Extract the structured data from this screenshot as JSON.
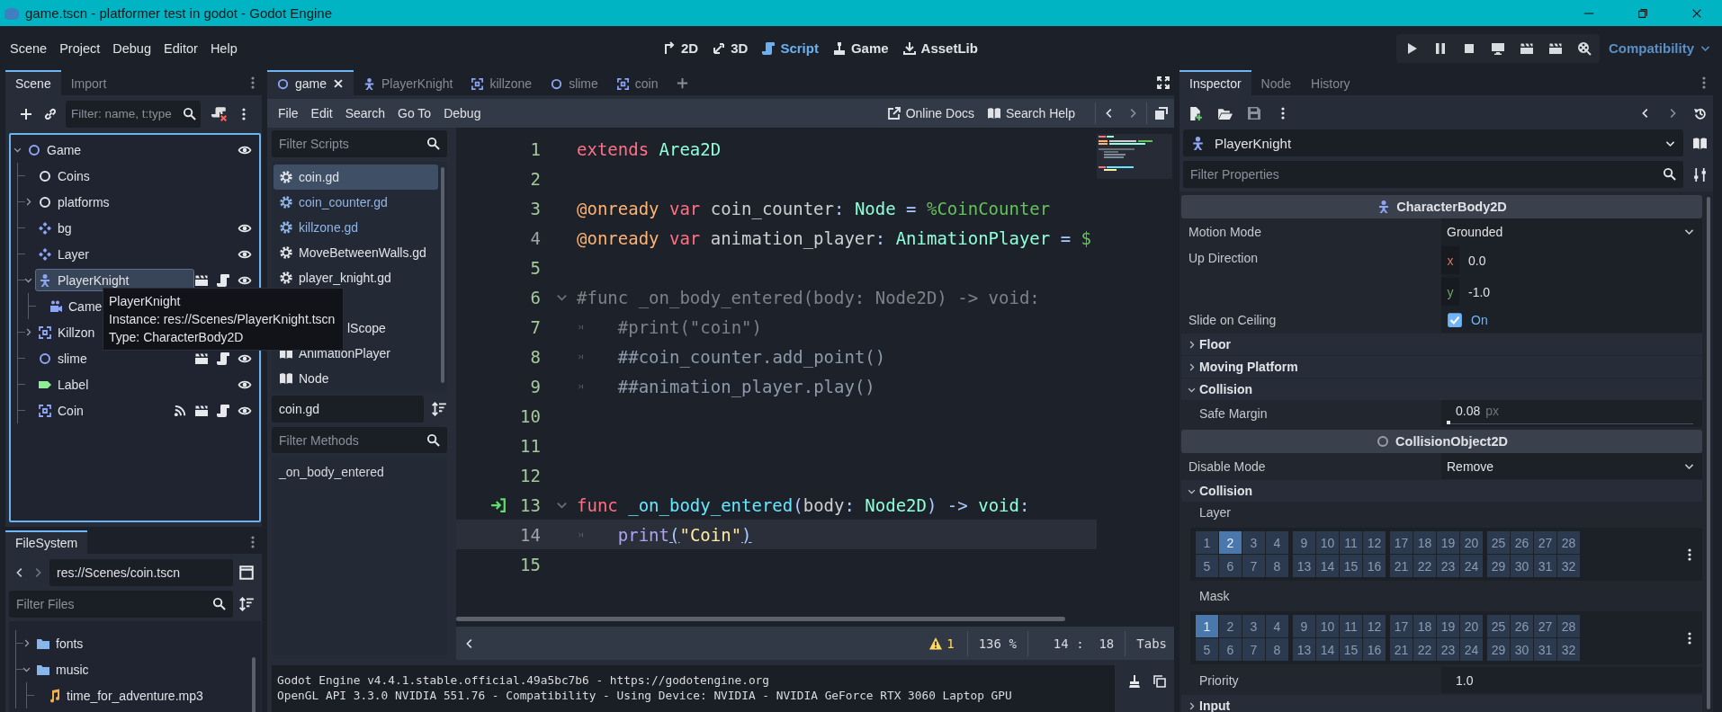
{
  "window": {
    "title": "game.tscn - platformer test in godot - Godot Engine"
  },
  "menu": [
    "Scene",
    "Project",
    "Debug",
    "Editor",
    "Help"
  ],
  "workspaces": [
    {
      "label": "2D",
      "kind": "planar",
      "selected": false
    },
    {
      "label": "3D",
      "kind": "spatial",
      "selected": false
    },
    {
      "label": "Script",
      "kind": "script",
      "selected": true
    },
    {
      "label": "Game",
      "kind": "game",
      "selected": false
    },
    {
      "label": "AssetLib",
      "kind": "assetlib",
      "selected": false
    }
  ],
  "renderer": "Compatibility",
  "scene_dock": {
    "tabs": [
      {
        "label": "Scene",
        "selected": true
      },
      {
        "label": "Import",
        "selected": false
      }
    ],
    "filter": {
      "placeholder": "Filter: name, t:type"
    },
    "tree": [
      {
        "label": "Game",
        "kind": "node2d",
        "expanded": true,
        "selected": false,
        "eye": true,
        "instanced": false,
        "script": false,
        "signals": false,
        "children": [
          {
            "label": "Coins",
            "kind": "node",
            "selected": false,
            "eye": false,
            "instanced": false,
            "script": false,
            "signals": false
          },
          {
            "label": "platforms",
            "kind": "node",
            "expanded": false,
            "selected": false,
            "eye": false,
            "instanced": false,
            "script": false,
            "signals": false
          },
          {
            "label": "bg",
            "kind": "tilemap",
            "selected": false,
            "eye": true,
            "instanced": false,
            "script": false,
            "signals": false
          },
          {
            "label": "Layer",
            "kind": "tilemap",
            "selected": false,
            "eye": true,
            "instanced": false,
            "script": false,
            "signals": false
          },
          {
            "label": "PlayerKnight",
            "kind": "character",
            "expanded": true,
            "selected": true,
            "eye": true,
            "instanced": true,
            "script": true,
            "signals": false,
            "children": [
              {
                "label": "Came",
                "kind": "camera",
                "selected": false,
                "eye": false,
                "instanced": false,
                "script": false,
                "signals": false
              }
            ]
          },
          {
            "label": "Killzon",
            "kind": "area",
            "expanded": false,
            "selected": false,
            "eye": false,
            "instanced": false,
            "script": false,
            "signals": false
          },
          {
            "label": "slime",
            "kind": "node2d",
            "selected": false,
            "eye": true,
            "instanced": true,
            "script": true,
            "signals": false
          },
          {
            "label": "Label",
            "kind": "label",
            "selected": false,
            "eye": true,
            "instanced": false,
            "script": false,
            "signals": false
          },
          {
            "label": "Coin",
            "kind": "area",
            "selected": false,
            "eye": true,
            "instanced": true,
            "script": true,
            "signals": true
          }
        ]
      }
    ]
  },
  "tooltip": {
    "lines": [
      "PlayerKnight",
      "Instance: res://Scenes/PlayerKnight.tscn",
      "Type: CharacterBody2D"
    ]
  },
  "filesystem": {
    "tabs": [
      {
        "label": "FileSystem",
        "selected": true
      }
    ],
    "path": "res://Scenes/coin.tscn",
    "filter": {
      "placeholder": "Filter Files"
    },
    "tree": [
      {
        "label": "fonts",
        "kind": "folder",
        "expanded": false,
        "selected": false
      },
      {
        "label": "music",
        "kind": "folder",
        "expanded": true,
        "selected": false,
        "children": [
          {
            "label": "time_for_adventure.mp3",
            "kind": "audio",
            "selected": false
          }
        ]
      }
    ]
  },
  "script_editor": {
    "tabs": [
      {
        "label": "game",
        "kind": "node2d",
        "selected": true
      },
      {
        "label": "PlayerKnight",
        "kind": "character",
        "selected": false
      },
      {
        "label": "killzone",
        "kind": "area",
        "selected": false
      },
      {
        "label": "slime",
        "kind": "node2d",
        "selected": false
      },
      {
        "label": "coin",
        "kind": "area",
        "selected": false
      }
    ],
    "menu": [
      "File",
      "Edit",
      "Search",
      "Go To",
      "Debug"
    ],
    "help": [
      {
        "label": "Online Docs",
        "kind": "external"
      },
      {
        "label": "Search Help",
        "kind": "help"
      }
    ],
    "script_filter": {
      "placeholder": "Filter Scripts"
    },
    "scripts": [
      {
        "label": "coin.gd",
        "kind": "script",
        "selected": true,
        "color": "#e2e4e8"
      },
      {
        "label": "coin_counter.gd",
        "kind": "script",
        "selected": false,
        "color": "#8fb6e8"
      },
      {
        "label": "killzone.gd",
        "kind": "script",
        "selected": false,
        "color": "#8fb6e8"
      },
      {
        "label": "MoveBetweenWalls.gd",
        "kind": "script",
        "selected": false,
        "color": "#e2e4e8"
      },
      {
        "label": "player_knight.gd",
        "kind": "script",
        "selected": false,
        "color": "#e2e4e8"
      },
      {
        "label": "lScope",
        "kind": "covered",
        "selected": false,
        "color": "#e2e4e8"
      },
      {
        "label": "AnimationPlayer",
        "kind": "doc",
        "selected": false,
        "color": "#e2e4e8"
      },
      {
        "label": "Node",
        "kind": "doc",
        "selected": false,
        "color": "#e2e4e8"
      }
    ],
    "current_script": "coin.gd",
    "method_filter": {
      "placeholder": "Filter Methods"
    },
    "methods": [
      "_on_body_entered"
    ],
    "lines": [
      {
        "number": "1",
        "safe": true,
        "current": false,
        "fold": false,
        "tab": false,
        "signal": false,
        "tokens": [
          {
            "text": "extends ",
            "kind": "keyword"
          },
          {
            "text": "Area2D",
            "kind": "type"
          }
        ]
      },
      {
        "number": "2",
        "safe": true,
        "current": false,
        "fold": false,
        "tab": false,
        "signal": false
      },
      {
        "number": "3",
        "safe": true,
        "current": false,
        "fold": false,
        "tab": false,
        "signal": false,
        "tokens": [
          {
            "text": "@onready ",
            "kind": "annotation"
          },
          {
            "text": "var",
            "kind": "keyword"
          },
          {
            "text": " coin_counter",
            "kind": "plain"
          },
          {
            "text": ": ",
            "kind": "symbol"
          },
          {
            "text": "Node ",
            "kind": "type"
          },
          {
            "text": "= ",
            "kind": "symbol"
          },
          {
            "text": "%CoinCounter",
            "kind": "node_path"
          }
        ]
      },
      {
        "number": "4",
        "safe": false,
        "current": false,
        "fold": false,
        "tab": false,
        "signal": false,
        "tokens": [
          {
            "text": "@onready ",
            "kind": "annotation"
          },
          {
            "text": "var",
            "kind": "keyword"
          },
          {
            "text": " animation_player",
            "kind": "plain"
          },
          {
            "text": ": ",
            "kind": "symbol"
          },
          {
            "text": "AnimationPlayer ",
            "kind": "type"
          },
          {
            "text": "= ",
            "kind": "symbol"
          },
          {
            "text": "$",
            "kind": "node_path"
          }
        ]
      },
      {
        "number": "5",
        "safe": true,
        "current": false,
        "fold": false,
        "tab": false,
        "signal": false
      },
      {
        "number": "6",
        "safe": true,
        "current": false,
        "fold": true,
        "tab": false,
        "signal": false,
        "tokens": [
          {
            "text": "#func _on_body_entered(body: Node2D) -> void:",
            "kind": "comment"
          }
        ]
      },
      {
        "number": "7",
        "safe": true,
        "current": false,
        "fold": false,
        "tab": true,
        "signal": false,
        "tokens": [
          {
            "text": "#print(\"coin\")",
            "kind": "comment"
          }
        ]
      },
      {
        "number": "8",
        "safe": true,
        "current": false,
        "fold": false,
        "tab": true,
        "signal": false,
        "tokens": [
          {
            "text": "##coin_counter.add_point()",
            "kind": "doc_comment"
          }
        ]
      },
      {
        "number": "9",
        "safe": true,
        "current": false,
        "fold": false,
        "tab": true,
        "signal": false,
        "tokens": [
          {
            "text": "##animation_player.play()",
            "kind": "doc_comment"
          }
        ]
      },
      {
        "number": "10",
        "safe": true,
        "current": false,
        "fold": false,
        "tab": false,
        "signal": false
      },
      {
        "number": "11",
        "safe": true,
        "current": false,
        "fold": false,
        "tab": false,
        "signal": false
      },
      {
        "number": "12",
        "safe": true,
        "current": false,
        "fold": false,
        "tab": false,
        "signal": false
      },
      {
        "number": "13",
        "safe": true,
        "current": false,
        "fold": true,
        "tab": false,
        "signal": true,
        "tokens": [
          {
            "text": "func ",
            "kind": "keyword"
          },
          {
            "text": "_on_body_entered",
            "kind": "function"
          },
          {
            "text": "(",
            "kind": "symbol"
          },
          {
            "text": "body",
            "kind": "plain"
          },
          {
            "text": ": ",
            "kind": "symbol"
          },
          {
            "text": "Node2D",
            "kind": "type"
          },
          {
            "text": ") -> ",
            "kind": "symbol"
          },
          {
            "text": "void",
            "kind": "type"
          },
          {
            "text": ":",
            "kind": "symbol"
          }
        ]
      },
      {
        "number": "14",
        "safe": false,
        "current": true,
        "fold": false,
        "tab": true,
        "signal": false,
        "tokens": [
          {
            "text": "print",
            "kind": "builtin"
          },
          {
            "text": "(",
            "kind": "bracket_match"
          },
          {
            "text": "\"Coin\"",
            "kind": "string"
          },
          {
            "text": ")",
            "kind": "bracket_match"
          }
        ]
      },
      {
        "number": "15",
        "safe": true,
        "current": false,
        "fold": false,
        "tab": false,
        "signal": false
      }
    ],
    "status": {
      "warnings": "1",
      "zoom": "136 %",
      "position": "14 :  18",
      "indent": "Tabs"
    }
  },
  "output": [
    "Godot Engine v4.4.1.stable.official.49a5bc7b6 - https://godotengine.org",
    "OpenGL API 3.3.0 NVIDIA 551.76 - Compatibility - Using Device: NVIDIA - NVIDIA GeForce RTX 3060 Laptop GPU"
  ],
  "inspector": {
    "tabs": [
      {
        "label": "Inspector",
        "selected": true
      },
      {
        "label": "Node",
        "selected": false
      },
      {
        "label": "History",
        "selected": false
      }
    ],
    "object": {
      "label": "PlayerKnight",
      "kind": "character"
    },
    "filter": {
      "placeholder": "Filter Properties"
    },
    "properties": [
      {
        "kind": "section",
        "label": "CharacterBody2D"
      },
      {
        "kind": "enum",
        "label": "Motion Mode",
        "value": "Grounded"
      },
      {
        "kind": "vector",
        "label": "Up Direction",
        "components": [
          {
            "axis": "x",
            "value": "0.0"
          },
          {
            "axis": "y",
            "value": "-1.0"
          }
        ]
      },
      {
        "kind": "check",
        "label": "Slide on Ceiling",
        "checked": true,
        "value": "On"
      },
      {
        "kind": "group",
        "label": "Floor",
        "expanded": false
      },
      {
        "kind": "group",
        "label": "Moving Platform",
        "expanded": false
      },
      {
        "kind": "group",
        "label": "Collision",
        "expanded": true,
        "children": [
          {
            "kind": "range",
            "label": "Safe Margin",
            "value": "0.08",
            "unit": "px",
            "level": 0
          }
        ]
      },
      {
        "kind": "basesection",
        "label": "CollisionObject2D"
      },
      {
        "kind": "enum",
        "label": "Disable Mode",
        "value": "Remove"
      },
      {
        "kind": "group",
        "label": "Collision",
        "expanded": true,
        "children": [
          {
            "kind": "bits",
            "label": "Layer",
            "bits": [
              {
                "label": "1",
                "selected": false
              },
              {
                "label": "2",
                "selected": true
              },
              {
                "label": "3",
                "selected": false
              },
              {
                "label": "4",
                "selected": false
              },
              {
                "label": "9",
                "selected": false
              },
              {
                "label": "10",
                "selected": false
              },
              {
                "label": "11",
                "selected": false
              },
              {
                "label": "12",
                "selected": false
              },
              {
                "label": "17",
                "selected": false
              },
              {
                "label": "18",
                "selected": false
              },
              {
                "label": "19",
                "selected": false
              },
              {
                "label": "20",
                "selected": false
              },
              {
                "label": "25",
                "selected": false
              },
              {
                "label": "26",
                "selected": false
              },
              {
                "label": "27",
                "selected": false
              },
              {
                "label": "28",
                "selected": false
              },
              {
                "label": "5",
                "selected": false
              },
              {
                "label": "6",
                "selected": false
              },
              {
                "label": "7",
                "selected": false
              },
              {
                "label": "8",
                "selected": false
              },
              {
                "label": "13",
                "selected": false
              },
              {
                "label": "14",
                "selected": false
              },
              {
                "label": "15",
                "selected": false
              },
              {
                "label": "16",
                "selected": false
              },
              {
                "label": "21",
                "selected": false
              },
              {
                "label": "22",
                "selected": false
              },
              {
                "label": "23",
                "selected": false
              },
              {
                "label": "24",
                "selected": false
              },
              {
                "label": "29",
                "selected": false
              },
              {
                "label": "30",
                "selected": false
              },
              {
                "label": "31",
                "selected": false
              },
              {
                "label": "32",
                "selected": false
              }
            ]
          },
          {
            "kind": "bits",
            "label": "Mask",
            "bits": [
              {
                "label": "1",
                "selected": true
              },
              {
                "label": "2",
                "selected": false
              },
              {
                "label": "3",
                "selected": false
              },
              {
                "label": "4",
                "selected": false
              },
              {
                "label": "9",
                "selected": false
              },
              {
                "label": "10",
                "selected": false
              },
              {
                "label": "11",
                "selected": false
              },
              {
                "label": "12",
                "selected": false
              },
              {
                "label": "17",
                "selected": false
              },
              {
                "label": "18",
                "selected": false
              },
              {
                "label": "19",
                "selected": false
              },
              {
                "label": "20",
                "selected": false
              },
              {
                "label": "25",
                "selected": false
              },
              {
                "label": "26",
                "selected": false
              },
              {
                "label": "27",
                "selected": false
              },
              {
                "label": "28",
                "selected": false
              },
              {
                "label": "5",
                "selected": false
              },
              {
                "label": "6",
                "selected": false
              },
              {
                "label": "7",
                "selected": false
              },
              {
                "label": "8",
                "selected": false
              },
              {
                "label": "13",
                "selected": false
              },
              {
                "label": "14",
                "selected": false
              },
              {
                "label": "15",
                "selected": false
              },
              {
                "label": "16",
                "selected": false
              },
              {
                "label": "21",
                "selected": false
              },
              {
                "label": "22",
                "selected": false
              },
              {
                "label": "23",
                "selected": false
              },
              {
                "label": "24",
                "selected": false
              },
              {
                "label": "29",
                "selected": false
              },
              {
                "label": "30",
                "selected": false
              },
              {
                "label": "31",
                "selected": false
              },
              {
                "label": "32",
                "selected": false
              }
            ]
          },
          {
            "kind": "number",
            "label": "Priority",
            "value": "1.0"
          }
        ]
      },
      {
        "kind": "group",
        "label": "Input",
        "expanded": false
      }
    ]
  }
}
